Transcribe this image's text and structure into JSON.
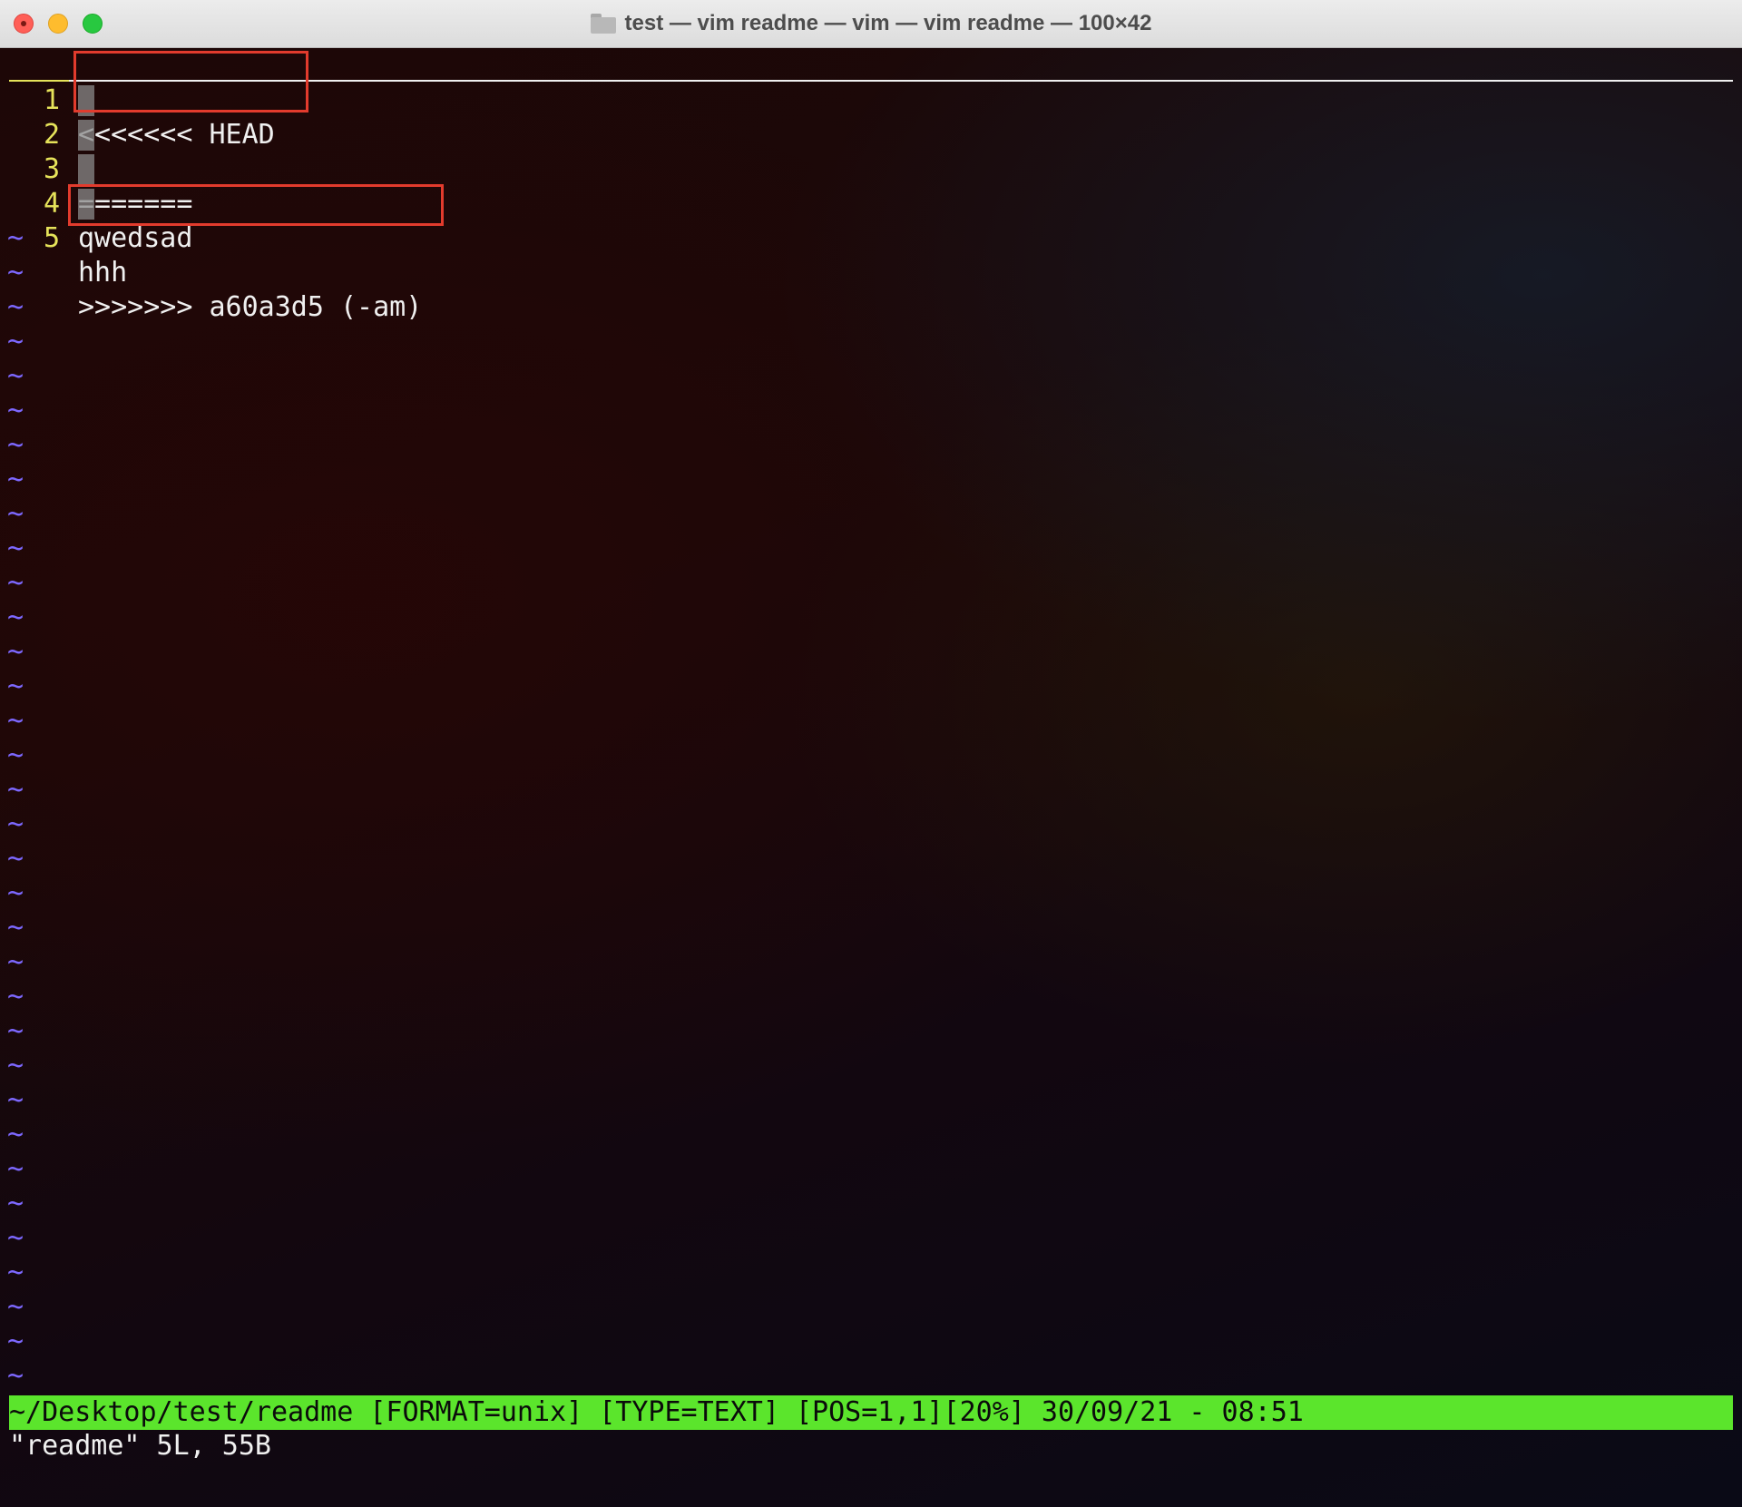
{
  "window": {
    "title": "test — vim readme — vim — vim readme — 100×42"
  },
  "editor": {
    "lines": [
      {
        "num": "1",
        "text": "<<<<<<< HEAD"
      },
      {
        "num": "2",
        "text": "======="
      },
      {
        "num": "3",
        "text": "qwedsad"
      },
      {
        "num": "4",
        "text": "hhh"
      },
      {
        "num": "5",
        "text": ">>>>>>> a60a3d5 (-am)"
      }
    ],
    "empty_line_marker": "~"
  },
  "statusline": {
    "text": "~/Desktop/test/readme [FORMAT=unix] [TYPE=TEXT] [POS=1,1][20%] 30/09/21 - 08:51"
  },
  "message": {
    "text": "\"readme\" 5L, 55B"
  },
  "colors": {
    "line_number": "#e6e35a",
    "text": "#f0f0f0",
    "tilde": "#7d68ff",
    "statusline_bg": "#5be52c",
    "highlight_box": "#e23b2d"
  }
}
